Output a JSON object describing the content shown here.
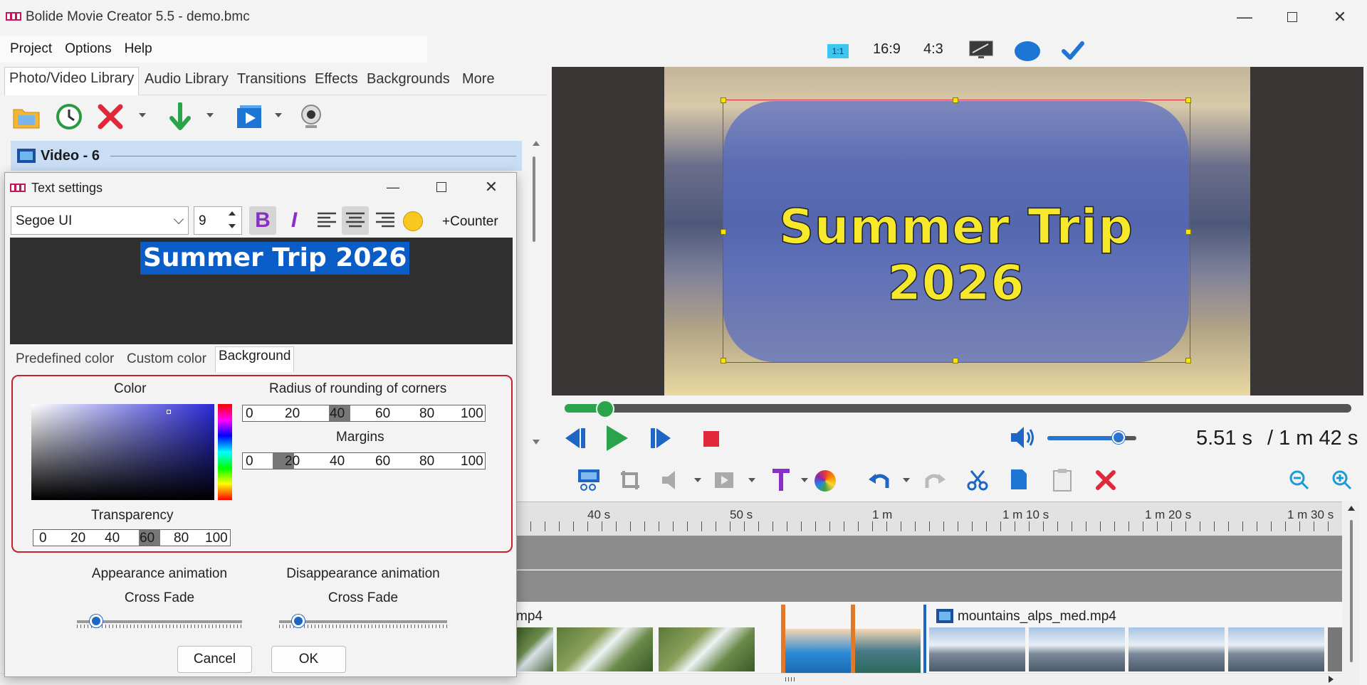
{
  "window": {
    "title": "Bolide Movie Creator 5.5 - demo.bmc"
  },
  "menu": [
    "Project",
    "Options",
    "Help"
  ],
  "aspect": {
    "one_to_one": "1:1",
    "wide": "16:9",
    "standard": "4:3"
  },
  "library_tabs": [
    "Photo/Video Library",
    "Audio Library",
    "Transitions",
    "Effects",
    "Backgrounds",
    "More"
  ],
  "library": {
    "group_label": "Video - 6"
  },
  "preview": {
    "overlay_text": "Summer Trip 2026"
  },
  "playback": {
    "current_time": "5.51 s",
    "total_time": "/ 1 m 42 s",
    "progress": 0.054,
    "volume": 0.8
  },
  "timeline": {
    "ruler_labels": [
      "40 s",
      "50 s",
      "1 m",
      "1 m 10 s",
      "1 m 20 s",
      "1 m 30 s"
    ],
    "clip_partial_label": "mp4",
    "clip_label": "mountains_alps_med.mp4"
  },
  "text_settings": {
    "title": "Text settings",
    "font": "Segoe UI",
    "size": "9",
    "counter_label": "+Counter",
    "text": "Summer Trip 2026",
    "tabs": [
      "Predefined color",
      "Custom color",
      "Background"
    ],
    "background": {
      "color_label": "Color",
      "radius_label": "Radius of rounding of corners",
      "margins_label": "Margins",
      "transparency_label": "Transparency",
      "scale_values": [
        "0",
        "20",
        "40",
        "60",
        "80",
        "100"
      ],
      "radius_value": 40,
      "margins_value": 20,
      "transparency_value": 60
    },
    "appearance_label": "Appearance animation",
    "appearance_value": "Cross Fade",
    "disappearance_label": "Disappearance animation",
    "disappearance_value": "Cross Fade",
    "cancel": "Cancel",
    "ok": "OK"
  },
  "colors": {
    "accent": "#1d66c4",
    "highlight_border": "#c8202c",
    "play_green": "#2aa44b",
    "delete_red": "#e0283a"
  }
}
